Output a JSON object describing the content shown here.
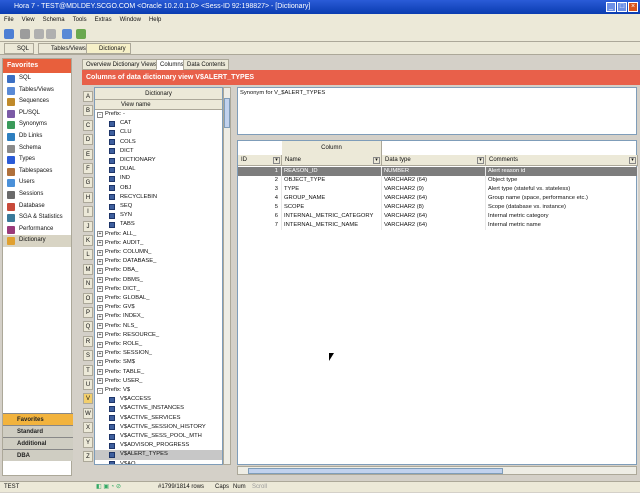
{
  "window": {
    "title": "Hora 7 - TEST@MDLDEY.SCGO.COM   <Oracle 10.2.0.1.0>   <Sess-ID 92:198827> - [Dictionary]"
  },
  "menu": [
    "File",
    "View",
    "Schema",
    "Tools",
    "Extras",
    "Window",
    "Help"
  ],
  "doc_tabs": [
    "SQL",
    "Tables/Views",
    "Dictionary"
  ],
  "sidebar": {
    "header": "Favorites",
    "items": [
      "SQL",
      "Tables/Views",
      "Sequences",
      "PL/SQL",
      "Synonyms",
      "Db Links",
      "Schema",
      "Types",
      "Tablespaces",
      "Users",
      "Sessions",
      "Database",
      "SGA & Statistics",
      "Performance",
      "Dictionary"
    ],
    "categories": [
      "Favorites",
      "Standard",
      "Additional",
      "DBA"
    ]
  },
  "view_tabs": [
    "Overview Dictionary Views",
    "Columns",
    "Data Contents"
  ],
  "banner": "Columns of data dictionary view V$ALERT_TYPES",
  "letters": [
    "A",
    "B",
    "C",
    "D",
    "E",
    "F",
    "G",
    "H",
    "I",
    "J",
    "K",
    "L",
    "M",
    "N",
    "O",
    "P",
    "Q",
    "R",
    "S",
    "T",
    "U",
    "V",
    "W",
    "X",
    "Y",
    "Z"
  ],
  "tree": {
    "header": "Dictionary",
    "subheader": "View name",
    "rows": [
      {
        "text": "Prefix: -",
        "kind": "prefix",
        "toggle": "-"
      },
      {
        "text": "CAT",
        "kind": "table"
      },
      {
        "text": "CLU",
        "kind": "table"
      },
      {
        "text": "COLS",
        "kind": "table"
      },
      {
        "text": "DICT",
        "kind": "table"
      },
      {
        "text": "DICTIONARY",
        "kind": "table"
      },
      {
        "text": "DUAL",
        "kind": "table"
      },
      {
        "text": "IND",
        "kind": "table"
      },
      {
        "text": "OBJ",
        "kind": "table"
      },
      {
        "text": "RECYCLEBIN",
        "kind": "table"
      },
      {
        "text": "SEQ",
        "kind": "table"
      },
      {
        "text": "SYN",
        "kind": "table"
      },
      {
        "text": "TABS",
        "kind": "table"
      },
      {
        "text": "Prefix: ALL_",
        "kind": "prefix",
        "toggle": "+"
      },
      {
        "text": "Prefix: AUDIT_",
        "kind": "prefix",
        "toggle": "+"
      },
      {
        "text": "Prefix: COLUMN_",
        "kind": "prefix",
        "toggle": "+"
      },
      {
        "text": "Prefix: DATABASE_",
        "kind": "prefix",
        "toggle": "+"
      },
      {
        "text": "Prefix: DBA_",
        "kind": "prefix",
        "toggle": "+"
      },
      {
        "text": "Prefix: DBMS_",
        "kind": "prefix",
        "toggle": "+"
      },
      {
        "text": "Prefix: DICT_",
        "kind": "prefix",
        "toggle": "+"
      },
      {
        "text": "Prefix: GLOBAL_",
        "kind": "prefix",
        "toggle": "+"
      },
      {
        "text": "Prefix: GV$",
        "kind": "prefix",
        "toggle": "+"
      },
      {
        "text": "Prefix: INDEX_",
        "kind": "prefix",
        "toggle": "+"
      },
      {
        "text": "Prefix: NLS_",
        "kind": "prefix",
        "toggle": "+"
      },
      {
        "text": "Prefix: RESOURCE_",
        "kind": "prefix",
        "toggle": "+"
      },
      {
        "text": "Prefix: ROLE_",
        "kind": "prefix",
        "toggle": "+"
      },
      {
        "text": "Prefix: SESSION_",
        "kind": "prefix",
        "toggle": "+"
      },
      {
        "text": "Prefix: SM$",
        "kind": "prefix",
        "toggle": "+"
      },
      {
        "text": "Prefix: TABLE_",
        "kind": "prefix",
        "toggle": "+"
      },
      {
        "text": "Prefix: USER_",
        "kind": "prefix",
        "toggle": "+"
      },
      {
        "text": "Prefix: V$",
        "kind": "prefix",
        "toggle": "-"
      },
      {
        "text": "V$ACCESS",
        "kind": "table"
      },
      {
        "text": "V$ACTIVE_INSTANCES",
        "kind": "table"
      },
      {
        "text": "V$ACTIVE_SERVICES",
        "kind": "table"
      },
      {
        "text": "V$ACTIVE_SESSION_HISTORY",
        "kind": "table"
      },
      {
        "text": "V$ACTIVE_SESS_POOL_MTH",
        "kind": "table"
      },
      {
        "text": "V$ADVISOR_PROGRESS",
        "kind": "table"
      },
      {
        "text": "V$ALERT_TYPES",
        "kind": "table",
        "selected": true
      },
      {
        "text": "V$AQ",
        "kind": "table"
      }
    ]
  },
  "synonym_text": "Synonym for V_$ALERT_TYPES",
  "columns": {
    "group_header": "Column",
    "headers": [
      "ID",
      "Name",
      "Data type",
      "Comments"
    ],
    "rows": [
      {
        "id": "1",
        "name": "REASON_ID",
        "type": "NUMBER",
        "comment": "Alert reason id",
        "selected": true
      },
      {
        "id": "2",
        "name": "OBJECT_TYPE",
        "type": "VARCHAR2 (64)",
        "comment": "Object type"
      },
      {
        "id": "3",
        "name": "TYPE",
        "type": "VARCHAR2 (9)",
        "comment": "Alert type (stateful vs. stateless)"
      },
      {
        "id": "4",
        "name": "GROUP_NAME",
        "type": "VARCHAR2 (64)",
        "comment": "Group name (space, performance etc.)"
      },
      {
        "id": "5",
        "name": "SCOPE",
        "type": "VARCHAR2 (8)",
        "comment": "Scope (database vs. instance)"
      },
      {
        "id": "6",
        "name": "INTERNAL_METRIC_CATEGORY",
        "type": "VARCHAR2 (64)",
        "comment": "Internal metric category"
      },
      {
        "id": "7",
        "name": "INTERNAL_METRIC_NAME",
        "type": "VARCHAR2 (64)",
        "comment": "Internal metric name"
      }
    ]
  },
  "status": {
    "connection": "TEST",
    "memory": "#1799/1814 rows",
    "caps": "Caps",
    "num": "Num",
    "scroll": "Scroll"
  }
}
